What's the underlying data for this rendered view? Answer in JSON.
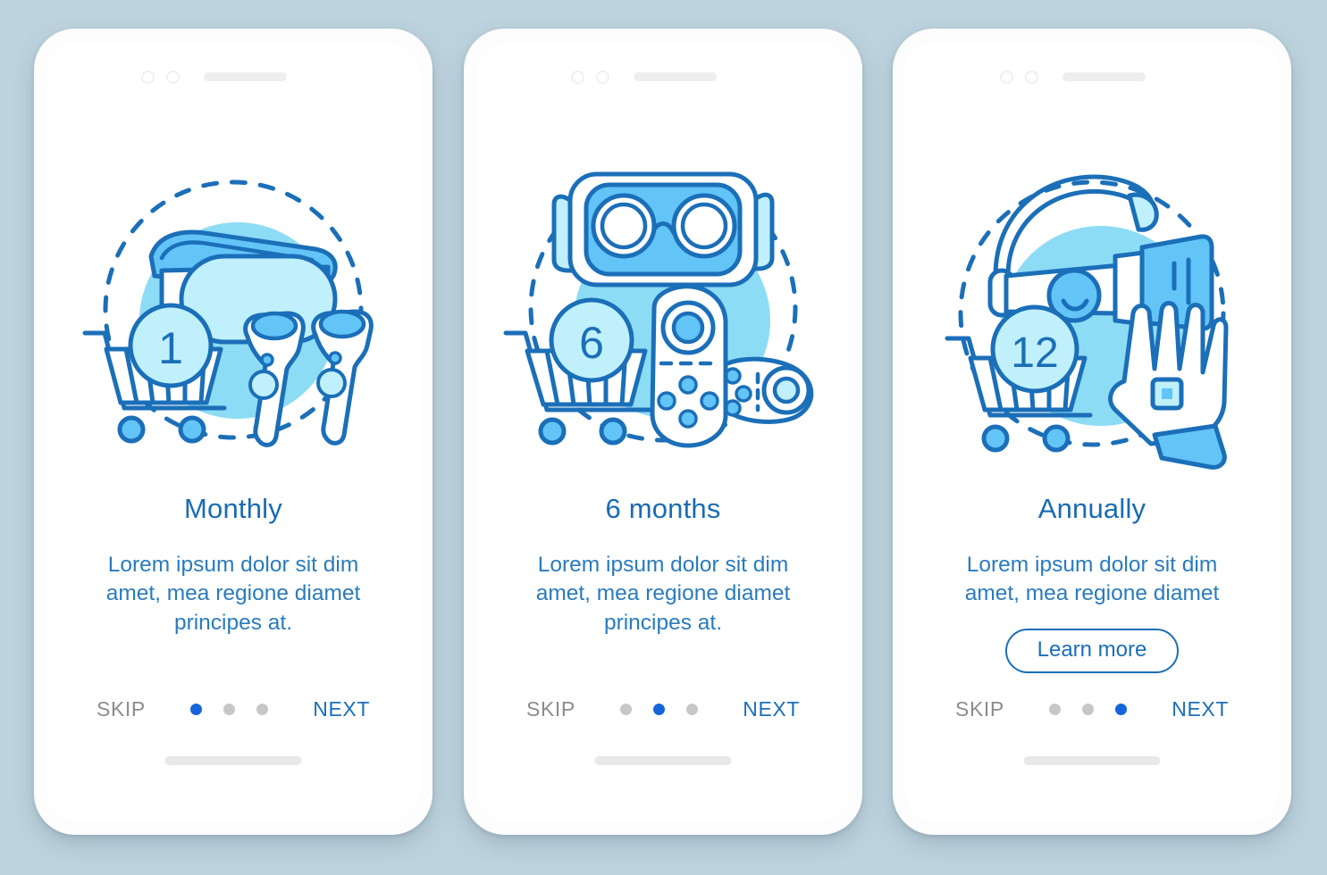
{
  "background_color": "#bdd3de",
  "theme": {
    "accent": "#1b6fb8",
    "title_color": "#1a6cb2",
    "body_color": "#2a7bbd",
    "skip_color": "#8c8c8c",
    "dot_active": "#1565d8",
    "dot_inactive": "#c7c7c7",
    "illus_circle": "#8ddcf5",
    "illus_line": "#1b6fb8",
    "illus_fill_light": "#bff0fb",
    "illus_fill_mid": "#63c4f7"
  },
  "screens": [
    {
      "id": "monthly",
      "illustration": "vr-headset-controllers-cart-icon",
      "badge_number": "1",
      "title": "Monthly",
      "description": "Lorem ipsum dolor sit dim amet, mea regione diamet principes at.",
      "has_learn_more": false,
      "learn_more_label": "",
      "skip_label": "SKIP",
      "next_label": "NEXT",
      "dots": 3,
      "active_dot": 0
    },
    {
      "id": "six-months",
      "illustration": "vr-goggles-gamepad-cart-icon",
      "badge_number": "6",
      "title": "6 months",
      "description": "Lorem ipsum dolor sit dim amet, mea regione diamet principes at.",
      "has_learn_more": false,
      "learn_more_label": "",
      "skip_label": "SKIP",
      "next_label": "NEXT",
      "dots": 3,
      "active_dot": 1
    },
    {
      "id": "annually",
      "illustration": "vr-headband-glove-cart-icon",
      "badge_number": "12",
      "title": "Annually",
      "description": "Lorem ipsum dolor sit dim amet, mea regione diamet",
      "has_learn_more": true,
      "learn_more_label": "Learn more",
      "skip_label": "SKIP",
      "next_label": "NEXT",
      "dots": 3,
      "active_dot": 2
    }
  ]
}
